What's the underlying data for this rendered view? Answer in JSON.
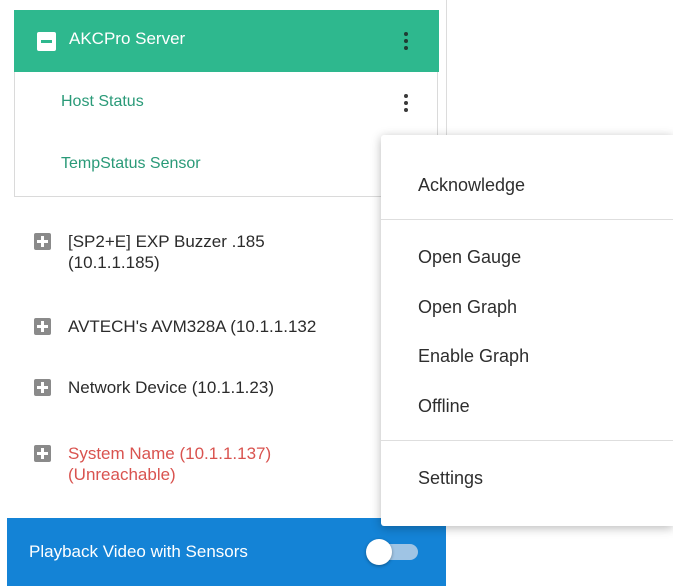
{
  "server": {
    "title": "AKCPro Server"
  },
  "sensors": [
    {
      "label": "Host Status"
    },
    {
      "label": "TempStatus Sensor"
    }
  ],
  "devices": [
    {
      "line1": "[SP2+E] EXP Buzzer .185",
      "line2": "(10.1.1.185)"
    },
    {
      "line1": "AVTECH's AVM328A (10.1.1.132",
      "line2": ""
    },
    {
      "line1": "Network Device (10.1.1.23)",
      "line2": ""
    },
    {
      "line1": "System Name (10.1.1.137)",
      "line2": "(Unreachable)",
      "status": "unreachable"
    }
  ],
  "playback": {
    "label": "Playback Video with Sensors",
    "enabled": false
  },
  "context_menu": {
    "items": [
      "Acknowledge",
      "Open Gauge",
      "Open Graph",
      "Enable Graph",
      "Offline",
      "Settings"
    ]
  },
  "colors": {
    "server_header": "#2eb88e",
    "sensor_text": "#2a9a78",
    "unreachable_text": "#d9534f",
    "playback_bar": "#1483d6"
  }
}
